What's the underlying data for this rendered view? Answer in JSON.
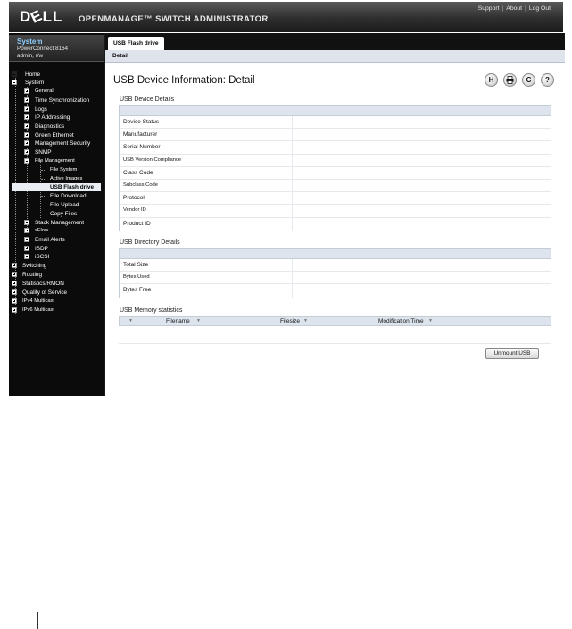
{
  "header": {
    "logo": "DELL",
    "product_title": "OPENMANAGE™ SWITCH ADMINISTRATOR",
    "links": [
      "Support",
      "About",
      "Log Out"
    ]
  },
  "system": {
    "title": "System",
    "model": "PowerConnect 8164",
    "user": "admin, r/w"
  },
  "nav": {
    "home": "Home",
    "system": "System",
    "general": "General",
    "time_sync": "Time Synchronization",
    "logs": "Logs",
    "ip_addressing": "IP Addressing",
    "diagnostics": "Diagnostics",
    "green_ethernet": "Green Ethernet",
    "management_security": "Management Security",
    "snmp": "SNMP",
    "file_management": "File Management",
    "file_system": "File System",
    "active_images": "Active Images",
    "usb_flash_drive": "USB Flash drive",
    "file_download": "File Download",
    "file_upload": "File Upload",
    "copy_files": "Copy Files",
    "stack_management": "Stack Management",
    "sflow": "sFlow",
    "email_alerts": "Email Alerts",
    "isdp": "ISDP",
    "iscsi": "iSCSI",
    "switching": "Switching",
    "routing": "Routing",
    "statistics_rmon": "Statistics/RMON",
    "qos": "Quality of Service",
    "ipv4_multicast": "IPv4 Multicast",
    "ipv6_multicast": "IPv6 Multicast"
  },
  "tabs": {
    "usb_flash_drive": "USB Flash drive",
    "detail": "Detail"
  },
  "page": {
    "title": "USB Device Information: Detail",
    "tool_icons": {
      "save": "H",
      "print": "print-icon",
      "refresh": "C",
      "help": "?"
    }
  },
  "device_details": {
    "title": "USB Device Details",
    "rows": [
      "Device Status",
      "Manufacturer",
      "Serial Number",
      "USB Version Compliance",
      "Class Code",
      "Subclass Code",
      "Protocol",
      "Vendor ID",
      "Product ID"
    ]
  },
  "directory_details": {
    "title": "USB Directory Details",
    "rows": [
      "Total Size",
      "Bytes Used",
      "Bytes Free"
    ]
  },
  "memory_stats": {
    "title": "USB Memory statistics",
    "columns": [
      "Filename",
      "Filesize",
      "Modification Time"
    ]
  },
  "buttons": {
    "unmount": "Unmount USB"
  }
}
